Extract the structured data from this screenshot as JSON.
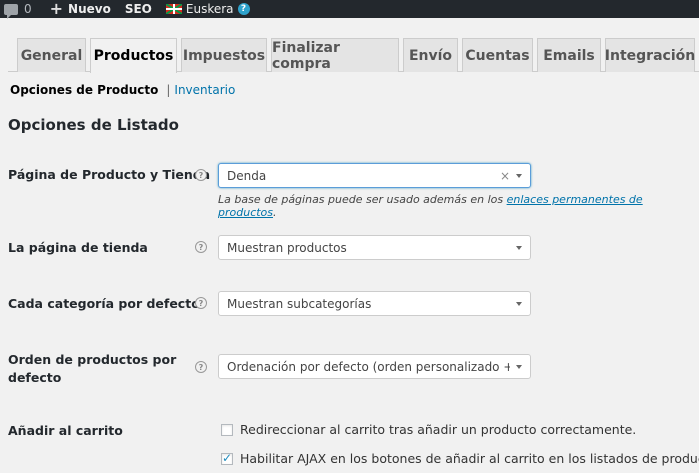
{
  "adminbar": {
    "comments_count": "0",
    "new_label": "Nuevo",
    "seo_label": "SEO",
    "language_label": "Euskera",
    "help_glyph": "?"
  },
  "tabs": [
    {
      "label": "General",
      "active": false
    },
    {
      "label": "Productos",
      "active": true
    },
    {
      "label": "Impuestos",
      "active": false
    },
    {
      "label": "Finalizar compra",
      "active": false
    },
    {
      "label": "Envío",
      "active": false
    },
    {
      "label": "Cuentas",
      "active": false
    },
    {
      "label": "Emails",
      "active": false
    },
    {
      "label": "Integración",
      "active": false
    }
  ],
  "subnav": {
    "current": "Opciones de Producto",
    "separator": "|",
    "other": "Inventario"
  },
  "section_title": "Opciones de Listado",
  "fields": {
    "shop_page": {
      "label": "Página de Producto y Tienda",
      "value": "Denda",
      "clear_glyph": "×",
      "desc_prefix": "La base de páginas puede ser usado además en los ",
      "desc_link": "enlaces permanentes de productos",
      "desc_suffix": "."
    },
    "shop_display": {
      "label": "La página de tienda",
      "value": "Muestran productos"
    },
    "category_display": {
      "label": "Cada categoría por defecto",
      "value": "Muestran subcategorías"
    },
    "default_order": {
      "label_line1": "Orden de productos por",
      "label_line2": "defecto",
      "value": "Ordenación por defecto (orden personalizado + n..."
    },
    "add_to_cart": {
      "label": "Añadir al carrito",
      "option1": {
        "label": "Redireccionar al carrito tras añadir un producto correctamente.",
        "checked": false
      },
      "option2": {
        "label": "Habilitar AJAX en los botones de añadir al carrito en los listados de producto",
        "checked": true
      }
    }
  },
  "help_glyph": "?",
  "colors": {
    "adminbar_bg": "#23282d",
    "link": "#0073aa",
    "page_bg": "#f1f1f1"
  }
}
